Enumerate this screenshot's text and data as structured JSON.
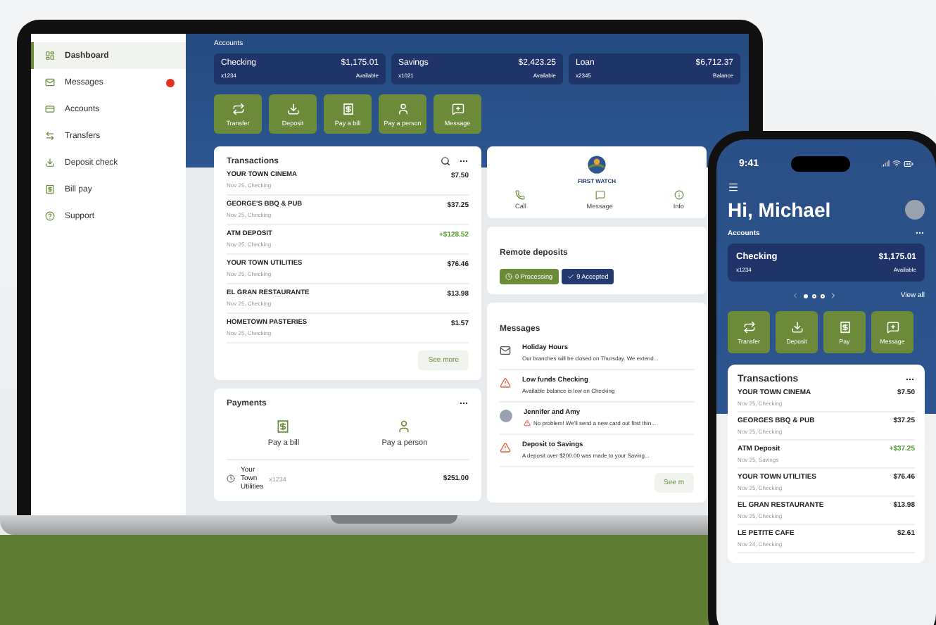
{
  "sidebar": {
    "items": [
      {
        "label": "Dashboard",
        "selected": true,
        "alert": false
      },
      {
        "label": "Messages",
        "selected": false,
        "alert": true
      },
      {
        "label": "Accounts",
        "selected": false,
        "alert": false
      },
      {
        "label": "Transfers",
        "selected": false,
        "alert": false
      },
      {
        "label": "Deposit check",
        "selected": false,
        "alert": false
      },
      {
        "label": "Bill pay",
        "selected": false,
        "alert": false
      },
      {
        "label": "Support",
        "selected": false,
        "alert": false
      }
    ]
  },
  "accounts": {
    "title": "Accounts",
    "items": [
      {
        "name": "Checking",
        "number": "x1234",
        "amount": "$1,175.01",
        "note": "Available"
      },
      {
        "name": "Savings",
        "number": "x1021",
        "amount": "$2,423.25",
        "note": "Available"
      },
      {
        "name": "Loan",
        "number": "x2345",
        "amount": "$6,712.37",
        "note": "Balance"
      }
    ]
  },
  "actions": [
    {
      "label": "Transfer"
    },
    {
      "label": "Deposit"
    },
    {
      "label": "Pay a bill"
    },
    {
      "label": "Pay a person"
    },
    {
      "label": "Message"
    }
  ],
  "transactions": {
    "title": "Transactions",
    "more": "See more",
    "rows": [
      {
        "name": "YOUR TOWN CINEMA",
        "detail": "Nov 25, Checking",
        "amount": "$7.50",
        "credit": false
      },
      {
        "name": "GEORGE'S BBQ & PUB",
        "detail": "Nov 25, Checking",
        "amount": "$37.25",
        "credit": false
      },
      {
        "name": "ATM DEPOSIT",
        "detail": "Nov 25, Checking",
        "amount": "+$128.52",
        "credit": true
      },
      {
        "name": "YOUR TOWN UTILITIES",
        "detail": "Nov 25, Checking",
        "amount": "$76.46",
        "credit": false
      },
      {
        "name": "EL GRAN RESTAURANTE",
        "detail": "Nov 25, Checking",
        "amount": "$13.98",
        "credit": false
      },
      {
        "name": "HOMETOWN PASTERIES",
        "detail": "Nov 25, Checking",
        "amount": "$1.57",
        "credit": false
      }
    ]
  },
  "payments": {
    "title": "Payments",
    "options": [
      {
        "label": "Pay a bill"
      },
      {
        "label": "Pay a person"
      }
    ],
    "rows": [
      {
        "name": "Your Town Utilities",
        "account": "x1234",
        "amount": "$251.00"
      }
    ]
  },
  "bank": {
    "logo": "FIRST WATCH",
    "actions": [
      {
        "label": "Call"
      },
      {
        "label": "Message"
      },
      {
        "label": "Info"
      }
    ]
  },
  "remote_deposits": {
    "title": "Remote deposits",
    "chips": [
      {
        "label": "0 Processing",
        "color": "#6b8a3a"
      },
      {
        "label": "9 Accepted",
        "color": "#233a6e"
      }
    ]
  },
  "messages": {
    "title": "Messages",
    "more": "See m",
    "items": [
      {
        "kind": "mail",
        "title": "Holiday Hours",
        "preview": "Our branches will be closed on Thursday. We extend..."
      },
      {
        "kind": "alert",
        "title": "Low funds Checking",
        "preview": "Available balance is low on Checking"
      },
      {
        "kind": "chat",
        "title": "Jennifer and Amy",
        "preview": "No problem! We'll send a new card out first thin..."
      },
      {
        "kind": "alert",
        "title": "Deposit to Savings",
        "preview": "A deposit over $200.00 was made to your Saving..."
      }
    ]
  },
  "phone": {
    "time": "9:41",
    "greeting": "Hi, Michael",
    "accounts_title": "Accounts",
    "account": {
      "name": "Checking",
      "number": "x1234",
      "amount": "$1,175.01",
      "note": "Available"
    },
    "pages": [
      {
        "selected": true
      },
      {
        "selected": false
      },
      {
        "selected": false
      }
    ],
    "view_all": "View all",
    "actions": [
      {
        "label": "Transfer"
      },
      {
        "label": "Deposit"
      },
      {
        "label": "Pay"
      },
      {
        "label": "Message"
      }
    ],
    "transactions": {
      "title": "Transactions",
      "rows": [
        {
          "name": "YOUR TOWN CINEMA",
          "detail": "Nov 25, Checking",
          "amount": "$7.50",
          "credit": false
        },
        {
          "name": "GEORGES BBQ & PUB",
          "detail": "Nov 25, Checking",
          "amount": "$37.25",
          "credit": false
        },
        {
          "name": "ATM Deposit",
          "detail": "Nov 25, Savings",
          "amount": "+$37.25",
          "credit": true
        },
        {
          "name": "YOUR TOWN UTILITIES",
          "detail": "Nov 25, Checking",
          "amount": "$76.46",
          "credit": false
        },
        {
          "name": "EL GRAN RESTAURANTE",
          "detail": "Nov 25, Checking",
          "amount": "$13.98",
          "credit": false
        },
        {
          "name": "LE PETITE CAFE",
          "detail": "Nov 24, Checking",
          "amount": "$2.61",
          "credit": false
        }
      ]
    }
  }
}
